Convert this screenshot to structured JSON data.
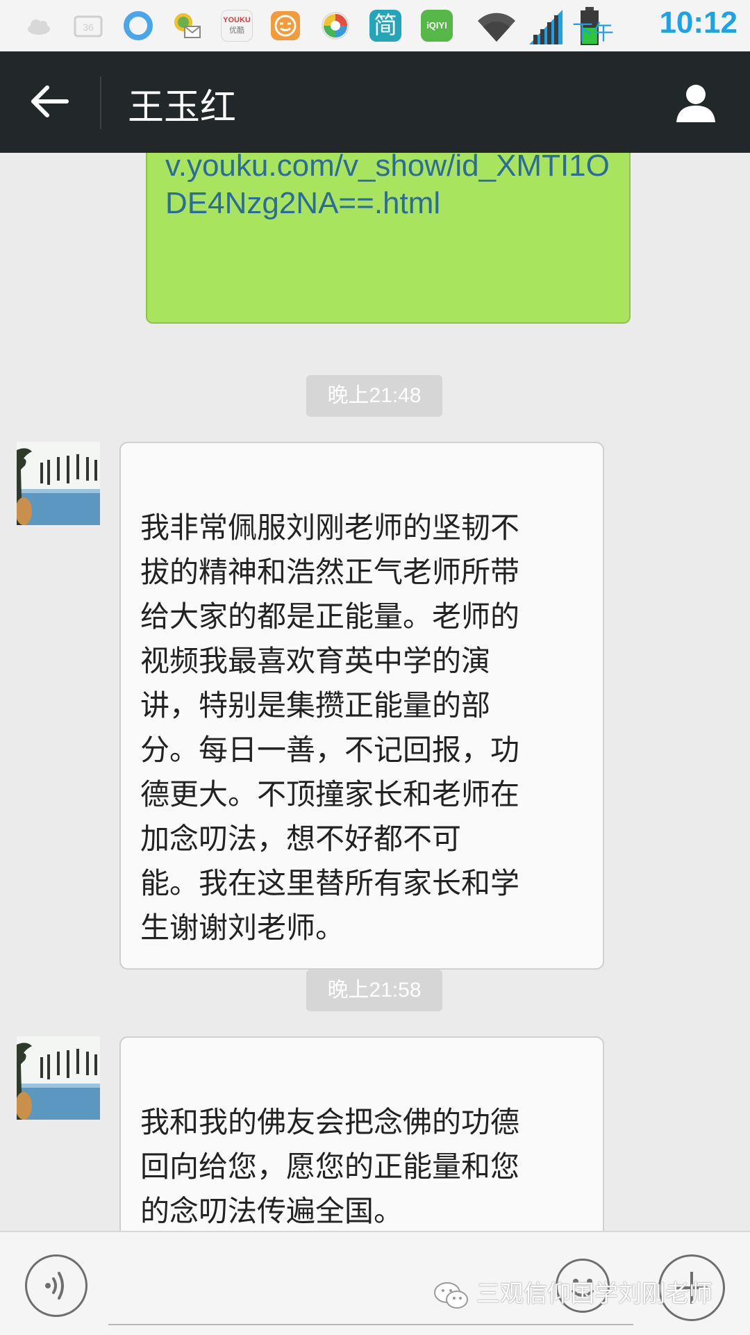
{
  "status_bar": {
    "ampm": "下午",
    "time": "10:12",
    "notification_icons": [
      "cloud-icon",
      "sim-icon",
      "browser-icon",
      "mail-icon",
      "youku-icon",
      "face-app-icon",
      "camera-app-icon",
      "jian-app-icon",
      "iqiyi-icon"
    ],
    "youku_text": "YOUKU",
    "youku_sub": "优酷",
    "jian_text": "简",
    "iqiyi_text": "iQIYI"
  },
  "header": {
    "title": "王玉红"
  },
  "messages": {
    "link_text": "v.youku.com/v_show/id_XMTI1ODE4Nzg2NA==.html",
    "time_1": "晚上21:48",
    "msg_1": "我非常佩服刘刚老师的坚韧不\n拔的精神和浩然正气老师所带\n给大家的都是正能量。老师的\n视频我最喜欢育英中学的演\n讲，特别是集攒正能量的部\n分。每日一善，不记回报，功\n德更大。不顶撞家长和老师在\n加念叨法，想不好都不可\n能。我在这里替所有家长和学\n生谢谢刘老师。",
    "time_2": "晚上21:58",
    "msg_2": "我和我的佛友会把念佛的功德\n回向给您，愿您的正能量和您\n的念叨法传遍全国。"
  },
  "watermark": {
    "text": "三观信仰国学刘刚老师"
  },
  "colors": {
    "header_bg": "#22282a",
    "link_bubble": "#a8e45d",
    "link_text": "#2b6c9a",
    "time_accent": "#1aa3e8"
  }
}
